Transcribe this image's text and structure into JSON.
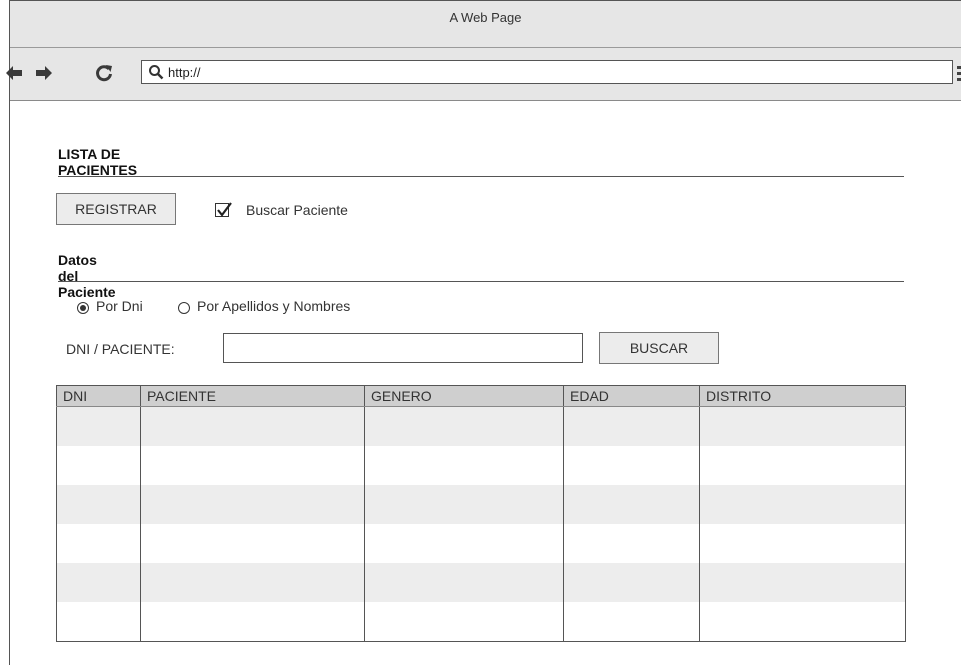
{
  "window": {
    "title": "A Web Page"
  },
  "browser": {
    "back_icon": "arrow-left-icon",
    "forward_icon": "arrow-right-icon",
    "reload_icon": "reload-icon",
    "url": "http://",
    "menu_icon": "hamburger-menu-icon"
  },
  "page": {
    "title": "LISTA DE PACIENTES",
    "register_button": "REGISTRAR",
    "search_checkbox": {
      "label": "Buscar Paciente",
      "checked": true
    },
    "section_title": "Datos del Paciente",
    "radios": [
      {
        "label": "Por Dni",
        "selected": true
      },
      {
        "label": "Por Apellidos y Nombres",
        "selected": false
      }
    ],
    "search_field": {
      "label": "DNI / PACIENTE:",
      "value": ""
    },
    "search_button": "BUSCAR"
  },
  "table": {
    "columns": [
      "DNI",
      "PACIENTE",
      "GENERO",
      "EDAD",
      "DISTRITO"
    ],
    "rows": [
      [
        "",
        "",
        "",
        "",
        ""
      ],
      [
        "",
        "",
        "",
        "",
        ""
      ],
      [
        "",
        "",
        "",
        "",
        ""
      ],
      [
        "",
        "",
        "",
        "",
        ""
      ],
      [
        "",
        "",
        "",
        "",
        ""
      ],
      [
        "",
        "",
        "",
        "",
        ""
      ]
    ]
  }
}
